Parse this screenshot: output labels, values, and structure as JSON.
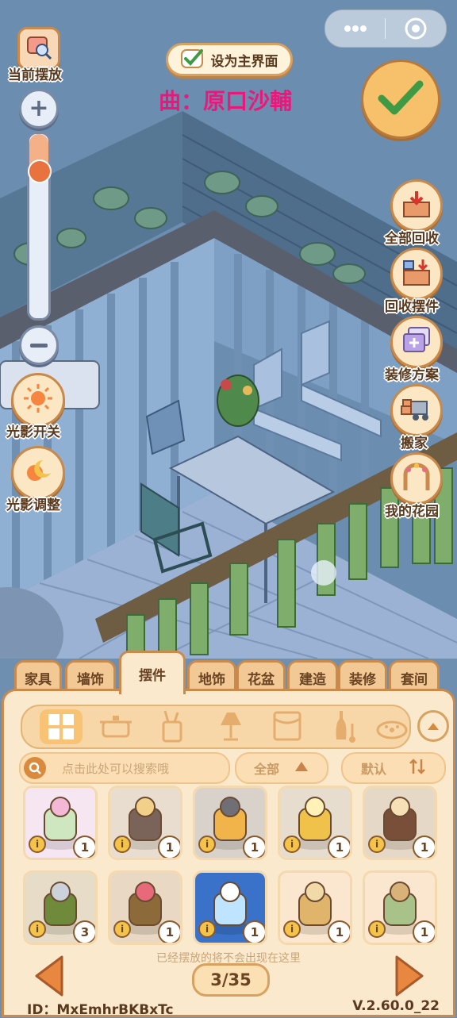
{
  "capsule": {
    "more_icon": "more-dots-icon",
    "close_icon": "target-close-icon"
  },
  "top": {
    "set_main_label": "设为主界面",
    "song_text": "曲：原口沙輔",
    "current_layout_label": "当前摆放"
  },
  "left_controls": {
    "light_toggle_label": "光影开关",
    "light_adjust_label": "光影调整",
    "zoom_level": 0.15
  },
  "right_controls": {
    "recall_all_label": "全部回收",
    "recall_item_label": "回收摆件",
    "plans_label": "装修方案",
    "move_label": "搬家",
    "garden_label": "我的花园"
  },
  "tabs": [
    {
      "label": "家具"
    },
    {
      "label": "墙饰"
    },
    {
      "label": "摆件",
      "active": true
    },
    {
      "label": "地饰"
    },
    {
      "label": "花盆"
    },
    {
      "label": "建造"
    },
    {
      "label": "装修"
    },
    {
      "label": "套间"
    }
  ],
  "filter": {
    "search_placeholder": "点击此处可以搜索哦",
    "category_select": "全部",
    "sort_select": "默认"
  },
  "items": [
    {
      "name": "cake",
      "count": "1"
    },
    {
      "name": "candelabra",
      "count": "1"
    },
    {
      "name": "camera-photos",
      "count": "1"
    },
    {
      "name": "golden-cake",
      "count": "1"
    },
    {
      "name": "lantern-candles",
      "count": "1"
    },
    {
      "name": "champagne-bucket",
      "count": "3"
    },
    {
      "name": "cocktail-tray",
      "count": "1"
    },
    {
      "name": "balloon-hologram",
      "count": "1"
    },
    {
      "name": "picnic-basket",
      "count": "1"
    },
    {
      "name": "milk-can",
      "count": "1"
    }
  ],
  "footer": {
    "notice": "已经摆放的将不会出现在这里",
    "page": "3/35",
    "id_text": "ID：MxEmhrBKBxTc",
    "version": "V.2.60.0_22"
  },
  "colors": {
    "song": "#e8197a",
    "accent": "#f0a24a",
    "panel": "#fbe9cd",
    "border": "#c98a4c"
  }
}
